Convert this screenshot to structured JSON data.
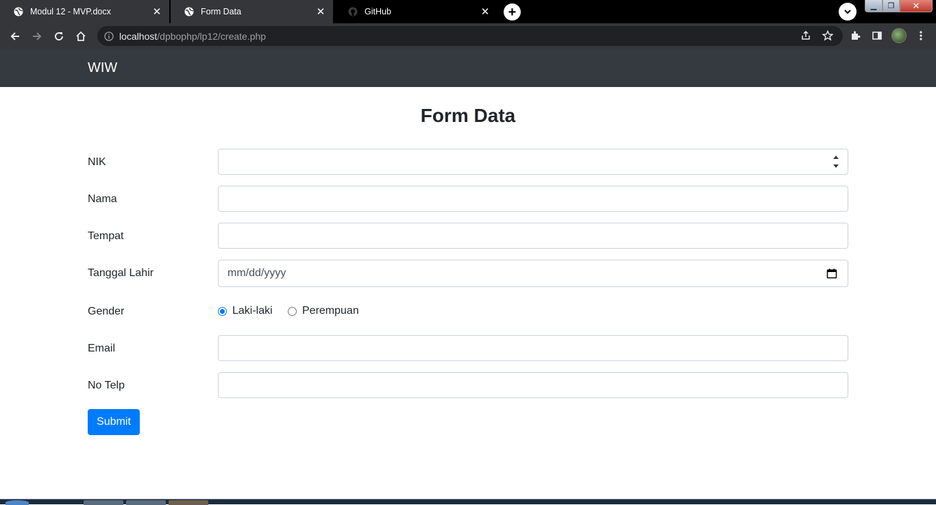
{
  "browser": {
    "tabs": [
      {
        "title": "Modul 12 - MVP.docx",
        "favicon": "globe-icon",
        "active": false
      },
      {
        "title": "Form Data",
        "favicon": "globe-icon",
        "active": true
      },
      {
        "title": "GitHub",
        "favicon": "github-icon",
        "active": false
      }
    ],
    "new_tab_icon": "plus-icon",
    "address_bar": {
      "host": "localhost",
      "path": "/dpbophp/lp12/create.php"
    }
  },
  "navbar": {
    "brand": "WIW"
  },
  "form": {
    "title": "Form Data",
    "fields": {
      "nik": {
        "label": "NIK",
        "value": ""
      },
      "nama": {
        "label": "Nama",
        "value": ""
      },
      "tempat": {
        "label": "Tempat",
        "value": ""
      },
      "tanggal_lahir": {
        "label": "Tanggal Lahir",
        "placeholder": "mm/dd/yyyy"
      },
      "gender": {
        "label": "Gender",
        "options": [
          {
            "label": "Laki-laki",
            "checked": true
          },
          {
            "label": "Perempuan",
            "checked": false
          }
        ]
      },
      "email": {
        "label": "Email",
        "value": ""
      },
      "no_telp": {
        "label": "No Telp",
        "value": ""
      }
    },
    "submit_label": "Submit"
  },
  "colors": {
    "navbar_bg": "#343a40",
    "primary": "#007bff",
    "radio_checked": "#0075ff",
    "browser_toolbar": "#35363a"
  }
}
